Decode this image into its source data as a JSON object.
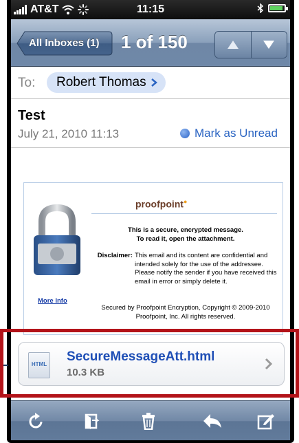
{
  "status_bar": {
    "carrier": "AT&T",
    "time": "11:15"
  },
  "nav": {
    "back_label": "All Inboxes (1)",
    "counter": "1 of 150",
    "up_icon": "arrow-up-icon",
    "down_icon": "arrow-down-icon"
  },
  "header": {
    "to_label": "To:",
    "recipient": "Robert Thomas",
    "subject": "Test",
    "date": "July 21, 2010 11:13",
    "mark_unread": "Mark as Unread"
  },
  "message": {
    "logo_text": "proofpoint",
    "secure_line1": "This is a secure, encrypted message.",
    "secure_line2": "To read it, open the attachment.",
    "disclaimer_label": "Disclaimer:",
    "disclaimer_text": "This email and its content are confidential and intended solely for the use of the addressee. Please notify the sender if you have received this email in error or simply delete it.",
    "more_info": "More Info",
    "copyright_line1": "Secured by Proofpoint Encryption, Copyright © 2009-2010",
    "copyright_line2": "Proofpoint, Inc. All rights reserved."
  },
  "attachment": {
    "icon_label": "HTML",
    "filename": "SecureMessageAtt.html",
    "size": "10.3 KB"
  },
  "toolbar": {
    "icons": [
      "refresh-icon",
      "move-folder-icon",
      "trash-icon",
      "reply-icon",
      "compose-icon"
    ]
  },
  "colors": {
    "nav_blue": "#6f87a6",
    "link_blue": "#1f4fb6",
    "highlight_red": "#b31319"
  }
}
